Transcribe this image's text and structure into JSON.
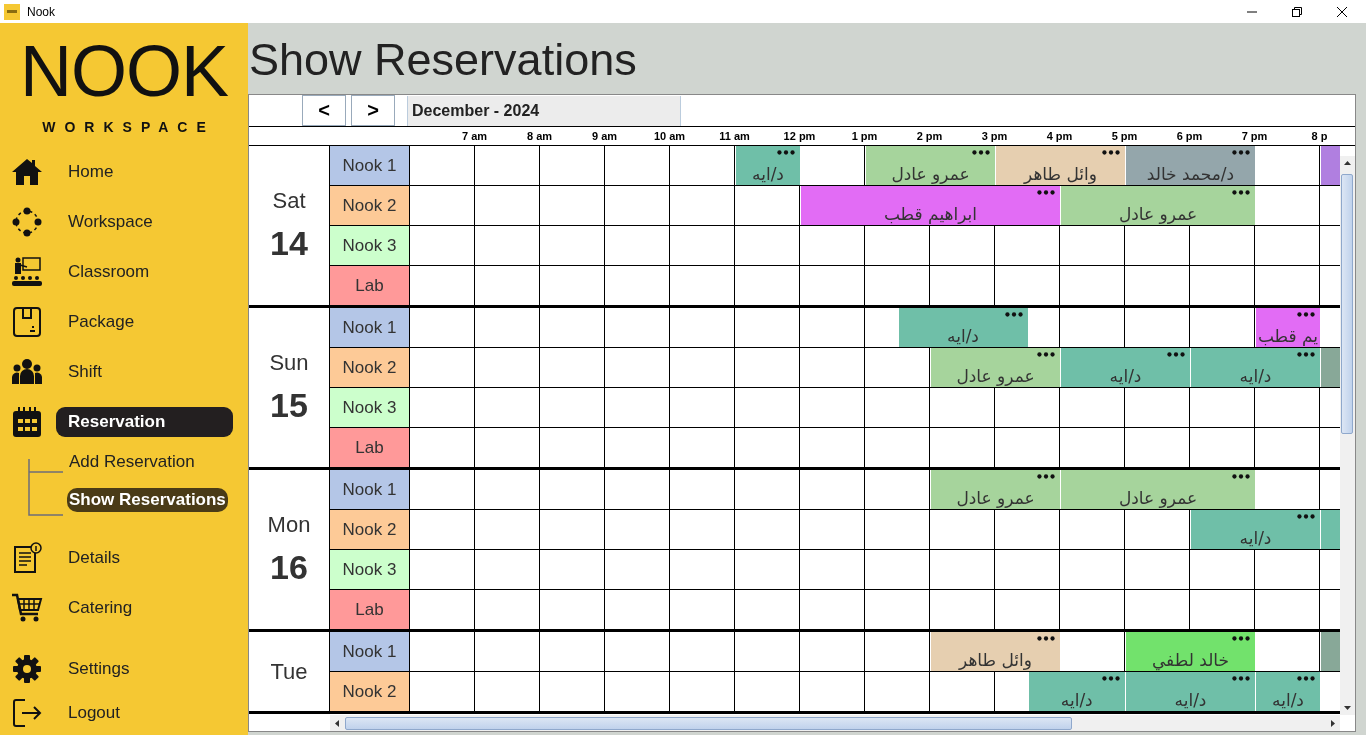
{
  "window": {
    "title": "Nook"
  },
  "logo": {
    "name": "NOOK",
    "tagline": "WORKSPACE"
  },
  "sidebar": {
    "items": [
      {
        "label": "Home",
        "selected": false
      },
      {
        "label": "Workspace",
        "selected": false
      },
      {
        "label": "Classroom",
        "selected": false
      },
      {
        "label": "Package",
        "selected": false
      },
      {
        "label": "Shift",
        "selected": false
      },
      {
        "label": "Reservation",
        "selected": true,
        "children": [
          {
            "label": "Add Reservation",
            "selected": false
          },
          {
            "label": "Show Reservations",
            "selected": true
          }
        ]
      },
      {
        "label": "Details",
        "selected": false
      },
      {
        "label": "Catering",
        "selected": false
      }
    ],
    "footer_items": [
      {
        "label": "Settings",
        "selected": false
      },
      {
        "label": "Logout",
        "selected": false
      }
    ]
  },
  "page": {
    "title": "Show Reservations"
  },
  "toolbar": {
    "prev": "<",
    "next": ">",
    "month": "December - 2024"
  },
  "schedule": {
    "hours": [
      "7 am",
      "8 am",
      "9 am",
      "10 am",
      "11 am",
      "12 pm",
      "1 pm",
      "2 pm",
      "3 pm",
      "4 pm",
      "5 pm",
      "6 pm",
      "7 pm",
      "8 p"
    ],
    "days": [
      {
        "weekday": "Sat",
        "date": "14",
        "rooms": [
          {
            "label": "Nook 1",
            "color": "#b4c6e7",
            "slots": [
              {
                "kind": "one",
                "color": "#b07fe0"
              },
              {
                "kind": "one"
              },
              {
                "kind": "two",
                "name": "د/محمد خالد",
                "color": "#94a6ab"
              },
              {
                "kind": "two",
                "name": "وائل طاهر",
                "color": "#e6cfb0"
              },
              {
                "kind": "two",
                "name": "عمرو عادل",
                "color": "#a6d49c"
              },
              {
                "kind": "one"
              },
              {
                "kind": "one",
                "name": "د/ايه",
                "color": "#6fbfa8"
              }
            ]
          },
          {
            "label": "Nook 2",
            "color": "#fdca97",
            "slots": [
              {
                "kind": "two"
              },
              {
                "kind": "three",
                "name": "عمرو عادل",
                "color": "#a6d49c"
              },
              {
                "kind": "four",
                "name": "ابراهيم قطب",
                "color": "#e26cf5"
              }
            ]
          },
          {
            "label": "Nook 3",
            "color": "#ccffcc"
          },
          {
            "label": "Lab",
            "color": "#ff9999"
          }
        ]
      },
      {
        "weekday": "Sun",
        "date": "15",
        "rooms": [
          {
            "label": "Nook 1",
            "color": "#b4c6e7",
            "slots": [
              {
                "kind": "one"
              },
              {
                "kind": "one",
                "name": "يم قطب",
                "color": "#e26cf5"
              },
              {
                "kind": "three"
              },
              {
                "kind": "half"
              },
              {
                "kind": "two",
                "name": "د/ايه",
                "color": "#6fbfa8"
              }
            ]
          },
          {
            "label": "Nook 2",
            "color": "#fdca97",
            "slots": [
              {
                "kind": "one",
                "color": "#88a898"
              },
              {
                "kind": "two",
                "name": "د/ايه",
                "color": "#6fbfa8"
              },
              {
                "kind": "two",
                "name": "د/ايه",
                "color": "#6fbfa8"
              },
              {
                "kind": "two",
                "name": "عمرو عادل",
                "color": "#a6d49c"
              }
            ]
          },
          {
            "label": "Nook 3",
            "color": "#ccffcc"
          },
          {
            "label": "Lab",
            "color": "#ff9999"
          }
        ]
      },
      {
        "weekday": "Mon",
        "date": "16",
        "rooms": [
          {
            "label": "Nook 1",
            "color": "#b4c6e7",
            "slots": [
              {
                "kind": "two"
              },
              {
                "kind": "three",
                "name": "عمرو عادل",
                "color": "#a6d49c"
              },
              {
                "kind": "two",
                "name": "عمرو عادل",
                "color": "#a6d49c"
              }
            ]
          },
          {
            "label": "Nook 2",
            "color": "#fdca97",
            "slots": [
              {
                "kind": "one",
                "color": "#6fbfa8"
              },
              {
                "kind": "two",
                "name": "د/ايه",
                "color": "#6fbfa8"
              }
            ]
          },
          {
            "label": "Nook 3",
            "color": "#ccffcc"
          },
          {
            "label": "Lab",
            "color": "#ff9999"
          }
        ]
      },
      {
        "weekday": "Tue",
        "rooms": [
          {
            "label": "Nook 1",
            "color": "#b4c6e7",
            "slots": [
              {
                "kind": "one",
                "color": "#88a898"
              },
              {
                "kind": "one"
              },
              {
                "kind": "two",
                "name": "خالد لطفي",
                "color": "#72e26c"
              },
              {
                "kind": "one"
              },
              {
                "kind": "two",
                "name": "وائل طاهر",
                "color": "#e6cfb0"
              }
            ]
          },
          {
            "label": "Nook 2",
            "color": "#fdca97",
            "slots": [
              {
                "kind": "one"
              },
              {
                "kind": "one",
                "name": "د/ايه",
                "color": "#6fbfa8"
              },
              {
                "kind": "two",
                "name": "د/ايه",
                "color": "#6fbfa8"
              },
              {
                "kind": "oneandhalf",
                "name": "د/ايه",
                "color": "#6fbfa8"
              }
            ]
          }
        ]
      }
    ]
  }
}
